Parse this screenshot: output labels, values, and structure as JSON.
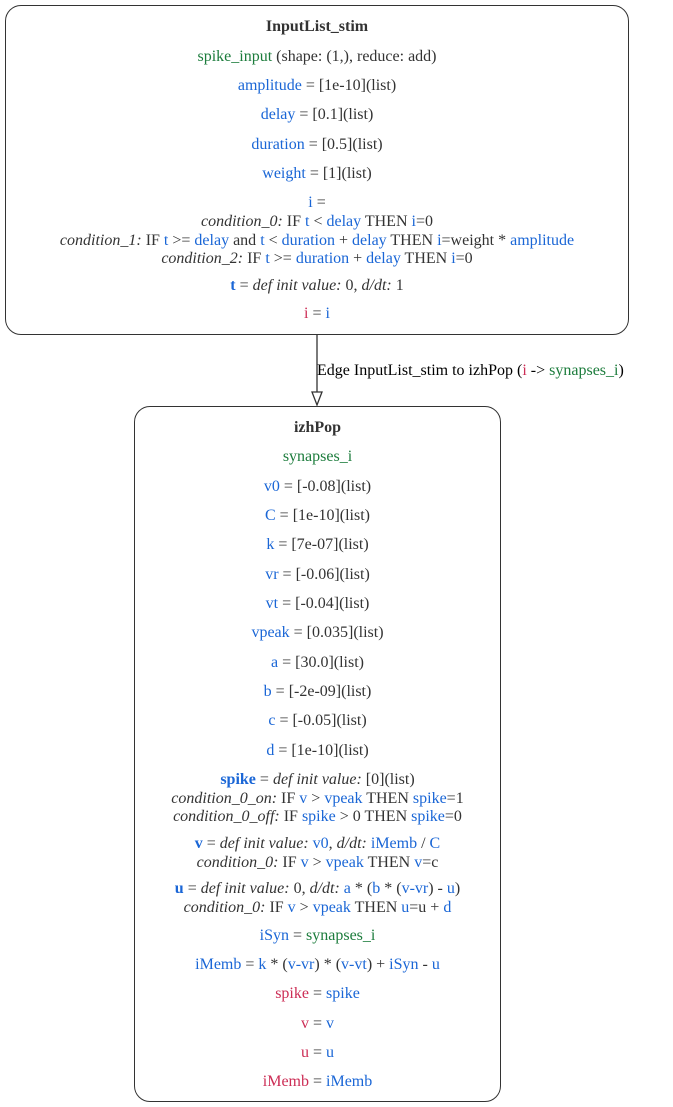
{
  "colors": {
    "variable": "#1a66d6",
    "port": "#1c7c3c",
    "output": "#cc2d55",
    "text": "#333333"
  },
  "node1": {
    "title": "InputList_stim",
    "port_name": "spike_input",
    "port_desc": " (shape: (1,), reduce: add)",
    "params": [
      {
        "name": "amplitude",
        "value": " = [1e-10](list)"
      },
      {
        "name": "delay",
        "value": " = [0.1](list)"
      },
      {
        "name": "duration",
        "value": " = [0.5](list)"
      },
      {
        "name": "weight",
        "value": " = [1](list)"
      }
    ],
    "i_block": {
      "head_name": "i",
      "head_eq": " =",
      "c0_label": "condition_0:",
      "c0_if": " IF ",
      "c0_t": "t",
      "c0_lt": " < ",
      "c0_delay": "delay",
      "c0_then": " THEN ",
      "c0_i": "i",
      "c0_val": "=0",
      "c1_label": "condition_1:",
      "c1_if": " IF ",
      "c1_t": "t",
      "c1_ge": " >= ",
      "c1_delay": "delay",
      "c1_and": " and ",
      "c1_t2": "t",
      "c1_lt": " < ",
      "c1_duration": "duration",
      "c1_plus": " + ",
      "c1_delay2": "delay",
      "c1_then": " THEN ",
      "c1_i": "i",
      "c1_eq": "=weight",
      "c1_times": " * ",
      "c1_amplitude": "amplitude",
      "c2_label": "condition_2:",
      "c2_if": " IF ",
      "c2_t": "t",
      "c2_ge": " >= ",
      "c2_duration": "duration",
      "c2_plus": " + ",
      "c2_delay": "delay",
      "c2_then": " THEN ",
      "c2_i": "i",
      "c2_val": "=0"
    },
    "t_state": {
      "name": "t",
      "eq": " = ",
      "def": "def init value:",
      "mid": " 0, ",
      "ddt": "d/dt:",
      "val": " 1"
    },
    "output": {
      "lhs": "i",
      "eq": " = ",
      "rhs": "i"
    }
  },
  "edge": {
    "text": "Edge InputList_stim to izhPop (",
    "src": "i",
    "arrow": " -> ",
    "dst": "synapses_i",
    "close": ")"
  },
  "node2": {
    "title": "izhPop",
    "port": "synapses_i",
    "params": [
      {
        "name": "v0",
        "value": " = [-0.08](list)"
      },
      {
        "name": "C",
        "value": " = [1e-10](list)"
      },
      {
        "name": "k",
        "value": " = [7e-07](list)"
      },
      {
        "name": "vr",
        "value": " = [-0.06](list)"
      },
      {
        "name": "vt",
        "value": " = [-0.04](list)"
      },
      {
        "name": "vpeak",
        "value": " = [0.035](list)"
      },
      {
        "name": "a",
        "value": " = [30.0](list)"
      },
      {
        "name": "b",
        "value": " = [-2e-09](list)"
      },
      {
        "name": "c",
        "value": " = [-0.05](list)"
      },
      {
        "name": "d",
        "value": " = [1e-10](list)"
      }
    ],
    "spike_state": {
      "name": "spike",
      "eq": " = ",
      "def": "def init value:",
      "val": " [0](list)",
      "c_on_label": "condition_0_on:",
      "c_on_if": " IF ",
      "c_on_v": "v",
      "c_on_gt": " > ",
      "c_on_vpeak": "vpeak",
      "c_on_then": " THEN ",
      "c_on_spike": "spike",
      "c_on_val": "=1",
      "c_off_label": "condition_0_off:",
      "c_off_if": " IF ",
      "c_off_spike": "spike",
      "c_off_gt": " > 0 THEN ",
      "c_off_spike2": "spike",
      "c_off_val": "=0"
    },
    "v_state": {
      "name": "v",
      "eq": " = ",
      "def": "def init value:",
      "sp": " ",
      "v0": "v0",
      "comma": ", ",
      "ddt": "d/dt:",
      "sp2": " ",
      "imemb": "iMemb",
      "div": " / ",
      "C": "C",
      "c_label": "condition_0:",
      "c_if": " IF ",
      "c_v": "v",
      "c_gt": " > ",
      "c_vpeak": "vpeak",
      "c_then": " THEN ",
      "c_v2": "v",
      "c_val": "=c"
    },
    "u_state": {
      "name": "u",
      "eq": " = ",
      "def": "def init value:",
      "mid": " 0, ",
      "ddt": "d/dt:",
      "sp": " ",
      "a": "a",
      "t1": " * (",
      "b": "b",
      "t2": " * (",
      "vvr": "v-vr",
      "t3": ") - ",
      "u": "u",
      "t4": ")",
      "c_label": "condition_0:",
      "c_if": " IF ",
      "c_v": "v",
      "c_gt": " > ",
      "c_vpeak": "vpeak",
      "c_then": " THEN ",
      "c_u": "u",
      "c_eq": "=u + ",
      "c_d": "d"
    },
    "isyn": {
      "lhs": "iSyn",
      "eq": " = ",
      "rhs": "synapses_i"
    },
    "imemb": {
      "lhs": "iMemb",
      "eq": " = ",
      "k": "k",
      "t1": " * (",
      "vvr": "v-vr",
      "t2": ") * (",
      "vvt": "v-vt",
      "t3": ") + ",
      "isyn": "iSyn",
      "t4": " - ",
      "u": "u"
    },
    "outputs": [
      {
        "lhs": "spike",
        "eq": " = ",
        "rhs": "spike"
      },
      {
        "lhs": "v",
        "eq": " = ",
        "rhs": "v"
      },
      {
        "lhs": "u",
        "eq": " = ",
        "rhs": "u"
      },
      {
        "lhs": "iMemb",
        "eq": " = ",
        "rhs": "iMemb"
      }
    ]
  }
}
